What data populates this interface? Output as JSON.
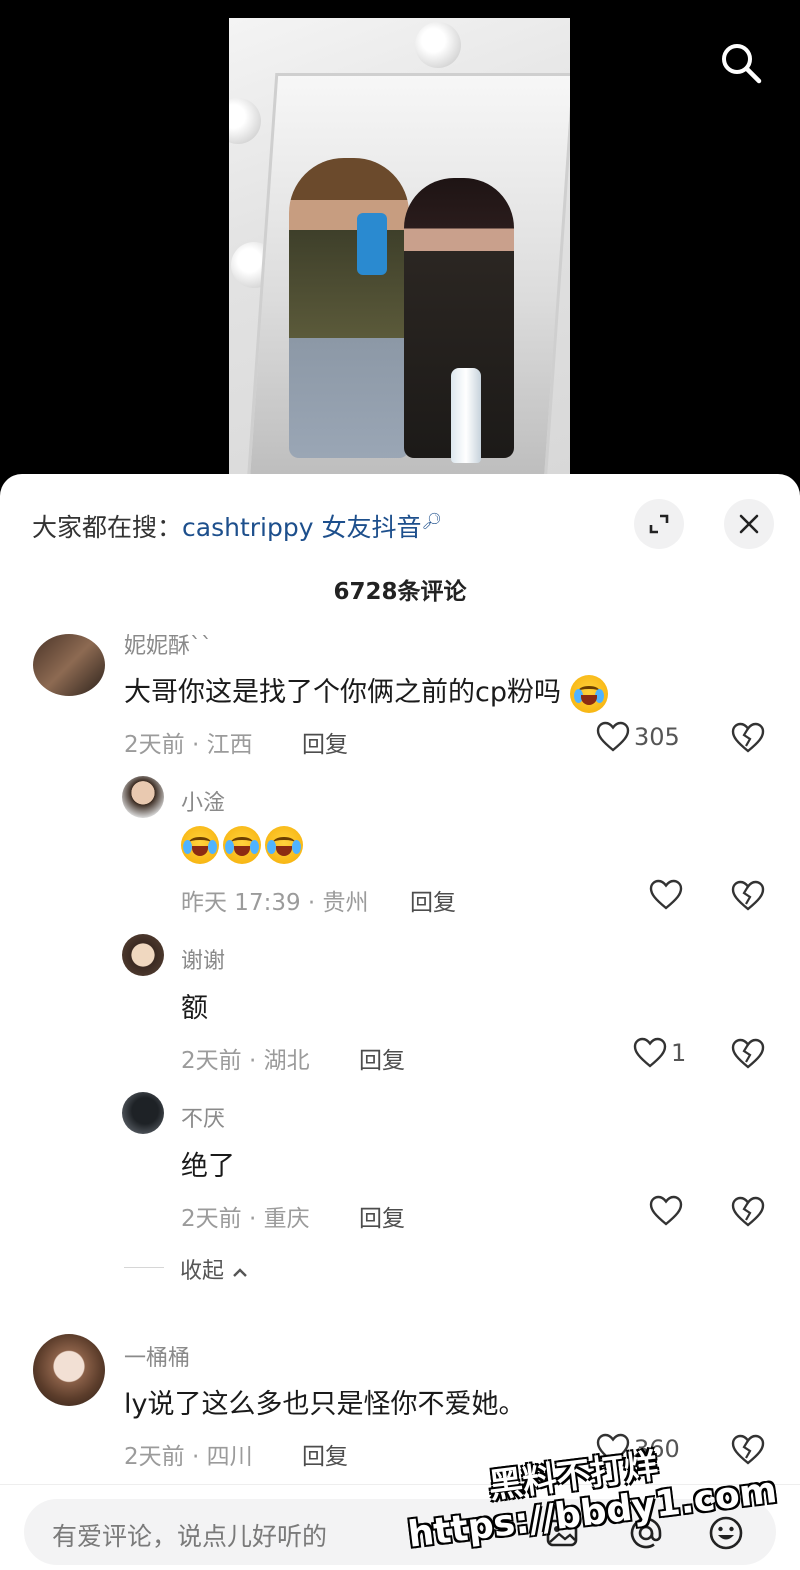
{
  "video": {
    "image_alt": "mirror selfie photo"
  },
  "hot_search": {
    "prefix": "大家都在搜：",
    "keyword": "cashtrippy 女友抖音"
  },
  "comment_count": "6728条评论",
  "comments": [
    {
      "username": "妮妮酥``",
      "text": "大哥你这是找了个你俩之前的cp粉吗",
      "meta": "2天前 · 江西",
      "reply_label": "回复",
      "likes": "305",
      "replies": [
        {
          "username": "小淦",
          "text": "",
          "emoji_count": 3,
          "meta": "昨天 17:39 · 贵州",
          "reply_label": "回复",
          "likes": ""
        },
        {
          "username": "谢谢",
          "text": "额",
          "meta": "2天前 · 湖北",
          "reply_label": "回复",
          "likes": "1"
        },
        {
          "username": "不厌",
          "text": "绝了",
          "meta": "2天前 · 重庆",
          "reply_label": "回复",
          "likes": ""
        }
      ]
    },
    {
      "username": "一桶桶",
      "text": "ly说了这么多也只是怪你不爱她。",
      "meta": "2天前 · 四川",
      "reply_label": "回复",
      "likes": "360"
    }
  ],
  "collapse_label": "收起",
  "input": {
    "placeholder": "有爱评论，说点儿好听的"
  },
  "watermark": {
    "line1": "黑料不打烊",
    "line2": "https://bbdy1.com"
  },
  "colors": {
    "link": "#1d4f8c",
    "sheet_bg": "#ffffff",
    "meta": "#9b9b9b"
  },
  "icons": [
    "search-icon",
    "expand-icon",
    "close-icon",
    "heart-icon",
    "broken-heart-icon",
    "image-icon",
    "at-icon",
    "emoji-icon"
  ]
}
